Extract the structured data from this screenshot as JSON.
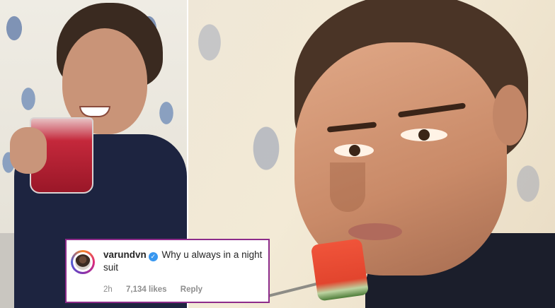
{
  "comment": {
    "username": "varundvn",
    "verified_icon": "verified-badge-icon",
    "text": "Why u always in a night suit",
    "time": "2h",
    "likes": "7,134 likes",
    "reply_label": "Reply"
  },
  "colors": {
    "card_border": "#8d2b8a",
    "verified": "#3897f0",
    "meta_text": "#8e8e8e"
  }
}
